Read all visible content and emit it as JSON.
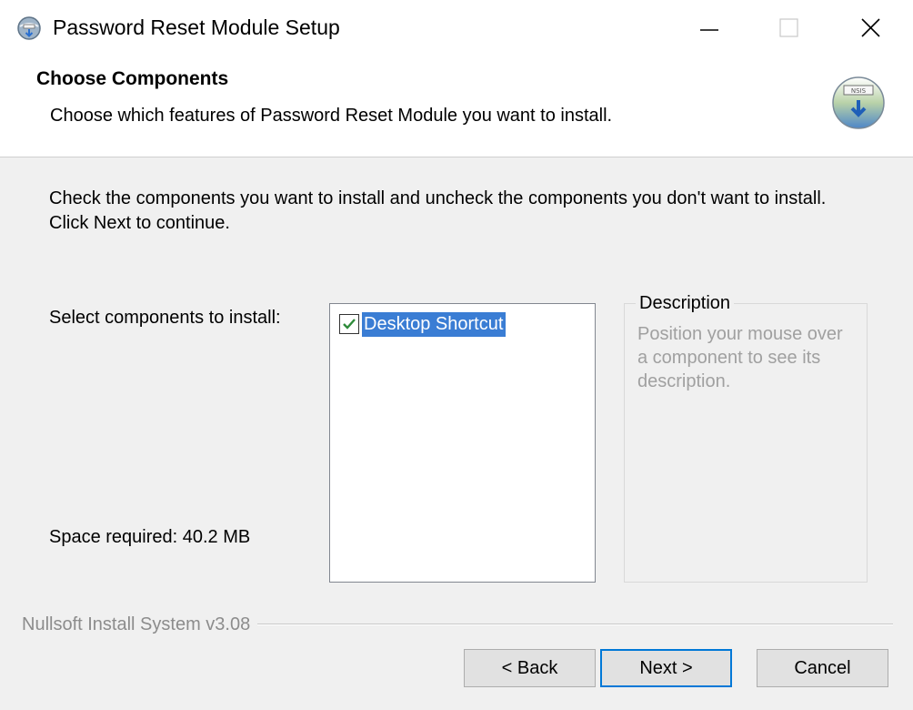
{
  "window": {
    "title": "Password Reset Module Setup",
    "icon": "installer-globe-icon",
    "controls": {
      "minimize": "minimize-icon",
      "maximize": "maximize-icon",
      "close": "close-icon"
    }
  },
  "header": {
    "title": "Choose Components",
    "subtitle": "Choose which features of Password Reset Module you want to install.",
    "logo_text": "NSIS"
  },
  "body": {
    "instructions": "Check the components you want to install and uncheck the components you don't want to install. Click Next to continue.",
    "select_label": "Select components to install:",
    "space_required": "Space required: 40.2 MB"
  },
  "components": [
    {
      "label": "Desktop Shortcut",
      "checked": true,
      "selected": true
    }
  ],
  "description": {
    "legend": "Description",
    "text": "Position your mouse over a component to see its description."
  },
  "branding": "Nullsoft Install System v3.08",
  "buttons": {
    "back": "< Back",
    "next": "Next >",
    "cancel": "Cancel"
  },
  "colors": {
    "selection": "#3a7dd4",
    "default_button_border": "#0078d7",
    "window_bg": "#f0f0f0"
  }
}
